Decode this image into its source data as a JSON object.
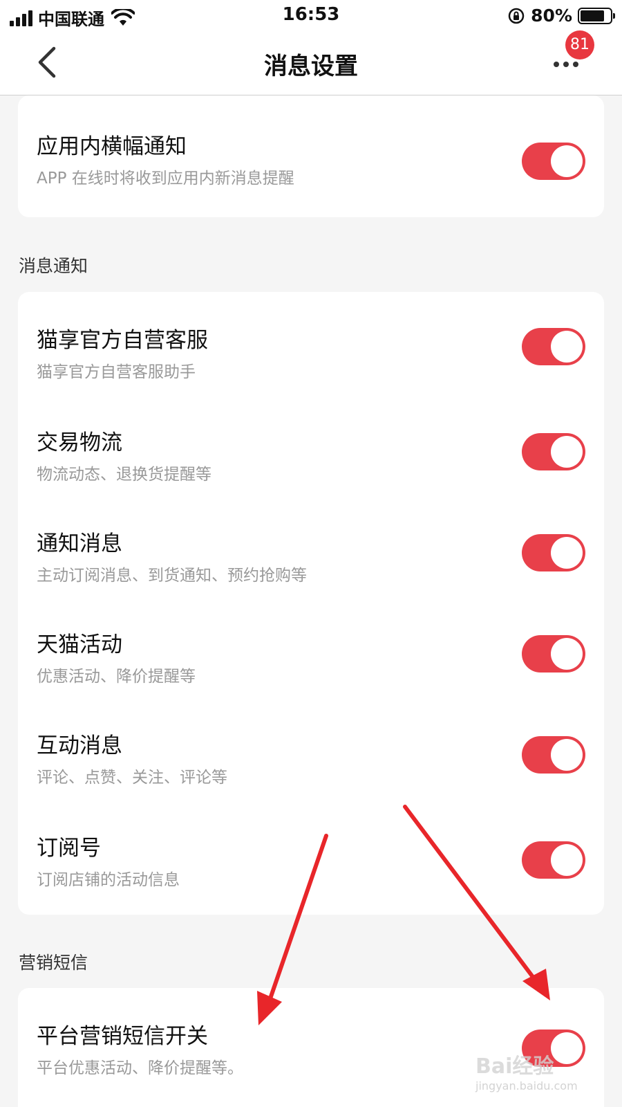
{
  "status_bar": {
    "carrier": "中国联通",
    "time": "16:53",
    "battery_pct": "80%"
  },
  "nav": {
    "title": "消息设置",
    "badge_count": "81"
  },
  "top_card": {
    "title": "应用内横幅通知",
    "subtitle": "APP 在线时将收到应用内新消息提醒",
    "toggle_on": true
  },
  "sections": [
    {
      "label": "消息通知",
      "items": [
        {
          "title": "猫享官方自营客服",
          "subtitle": "猫享官方自营客服助手",
          "toggle_on": true
        },
        {
          "title": "交易物流",
          "subtitle": "物流动态、退换货提醒等",
          "toggle_on": true
        },
        {
          "title": "通知消息",
          "subtitle": "主动订阅消息、到货通知、预约抢购等",
          "toggle_on": true
        },
        {
          "title": "天猫活动",
          "subtitle": "优惠活动、降价提醒等",
          "toggle_on": true
        },
        {
          "title": "互动消息",
          "subtitle": "评论、点赞、关注、评论等",
          "toggle_on": true
        },
        {
          "title": "订阅号",
          "subtitle": "订阅店铺的活动信息",
          "toggle_on": true
        }
      ]
    },
    {
      "label": "营销短信",
      "items": [
        {
          "title": "平台营销短信开关",
          "subtitle": "平台优惠活动、降价提醒等。",
          "toggle_on": true
        }
      ]
    }
  ],
  "watermark": {
    "brand": "Bai经验",
    "url": "jingyan.baidu.com"
  },
  "colors": {
    "accent": "#e8404a",
    "badge": "#e8373f",
    "arrow": "#e8262a"
  },
  "icons": {
    "back": "chevron-left-icon",
    "more": "more-dots-icon",
    "wifi": "wifi-icon",
    "rotation_lock": "rotation-lock-icon",
    "battery": "battery-icon"
  }
}
